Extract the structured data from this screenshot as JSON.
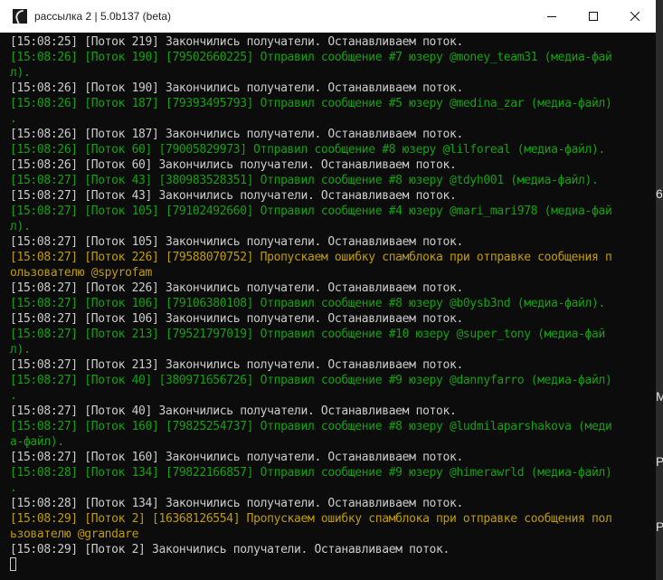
{
  "window": {
    "title": "рассылка 2 | 5.0b137 (beta)"
  },
  "colors": {
    "white": "#cccccc",
    "green": "#13a10e",
    "yellow": "#c19c00"
  },
  "terminal": {
    "lines": [
      {
        "color": "white",
        "text": "[15:08:25] [Поток 219] Закончились получатели. Останавливаем поток."
      },
      {
        "color": "green",
        "text": "[15:08:26] [Поток 190] [79502660225] Отправил сообщение #7 юзеру @money_team31 (медиа-фай"
      },
      {
        "color": "green",
        "text": "л)."
      },
      {
        "color": "white",
        "text": "[15:08:26] [Поток 190] Закончились получатели. Останавливаем поток."
      },
      {
        "color": "green",
        "text": "[15:08:26] [Поток 187] [79393495793] Отправил сообщение #5 юзеру @medina_zar (медиа-файл)"
      },
      {
        "color": "green",
        "text": "."
      },
      {
        "color": "white",
        "text": "[15:08:26] [Поток 187] Закончились получатели. Останавливаем поток."
      },
      {
        "color": "green",
        "text": "[15:08:26] [Поток 60] [79005829973] Отправил сообщение #8 юзеру @lilforeal (медиа-файл)."
      },
      {
        "color": "white",
        "text": "[15:08:26] [Поток 60] Закончились получатели. Останавливаем поток."
      },
      {
        "color": "green",
        "text": "[15:08:27] [Поток 43] [380983528351] Отправил сообщение #8 юзеру @tdyh001 (медиа-файл)."
      },
      {
        "color": "white",
        "text": "[15:08:27] [Поток 43] Закончились получатели. Останавливаем поток."
      },
      {
        "color": "green",
        "text": "[15:08:27] [Поток 105] [79102492660] Отправил сообщение #4 юзеру @mari_mari978 (медиа-фай"
      },
      {
        "color": "green",
        "text": "л)."
      },
      {
        "color": "white",
        "text": "[15:08:27] [Поток 105] Закончились получатели. Останавливаем поток."
      },
      {
        "color": "yellow",
        "text": "[15:08:27] [Поток 226] [79588070752] Пропускаем ошибку спамблока при отправке сообщения п"
      },
      {
        "color": "yellow",
        "text": "ользователю @spyrofam"
      },
      {
        "color": "white",
        "text": "[15:08:27] [Поток 226] Закончились получатели. Останавливаем поток."
      },
      {
        "color": "green",
        "text": "[15:08:27] [Поток 106] [79106380108] Отправил сообщение #8 юзеру @b0ysb3nd (медиа-файл)."
      },
      {
        "color": "white",
        "text": "[15:08:27] [Поток 106] Закончились получатели. Останавливаем поток."
      },
      {
        "color": "green",
        "text": "[15:08:27] [Поток 213] [79521797019] Отправил сообщение #10 юзеру @super_tony (медиа-фай"
      },
      {
        "color": "green",
        "text": "л)."
      },
      {
        "color": "white",
        "text": "[15:08:27] [Поток 213] Закончились получатели. Останавливаем поток."
      },
      {
        "color": "green",
        "text": "[15:08:27] [Поток 40] [380971656726] Отправил сообщение #9 юзеру @dannyfarro (медиа-файл)"
      },
      {
        "color": "green",
        "text": "."
      },
      {
        "color": "white",
        "text": "[15:08:27] [Поток 40] Закончились получатели. Останавливаем поток."
      },
      {
        "color": "green",
        "text": "[15:08:27] [Поток 160] [79825254737] Отправил сообщение #8 юзеру @ludmilaparshakova (меди"
      },
      {
        "color": "green",
        "text": "а-файл)."
      },
      {
        "color": "white",
        "text": "[15:08:27] [Поток 160] Закончились получатели. Останавливаем поток."
      },
      {
        "color": "green",
        "text": "[15:08:28] [Поток 134] [79822166857] Отправил сообщение #9 юзеру @himerawrld (медиа-файл)"
      },
      {
        "color": "green",
        "text": "."
      },
      {
        "color": "white",
        "text": "[15:08:28] [Поток 134] Закончились получатели. Останавливаем поток."
      },
      {
        "color": "yellow",
        "text": "[15:08:29] [Поток 2] [16368126554] Пропускаем ошибку спамблока при отправке сообщения пол"
      },
      {
        "color": "yellow",
        "text": "ьзователю @grandare"
      },
      {
        "color": "white",
        "text": "[15:08:29] [Поток 2] Закончились получатели. Останавливаем поток."
      }
    ]
  }
}
